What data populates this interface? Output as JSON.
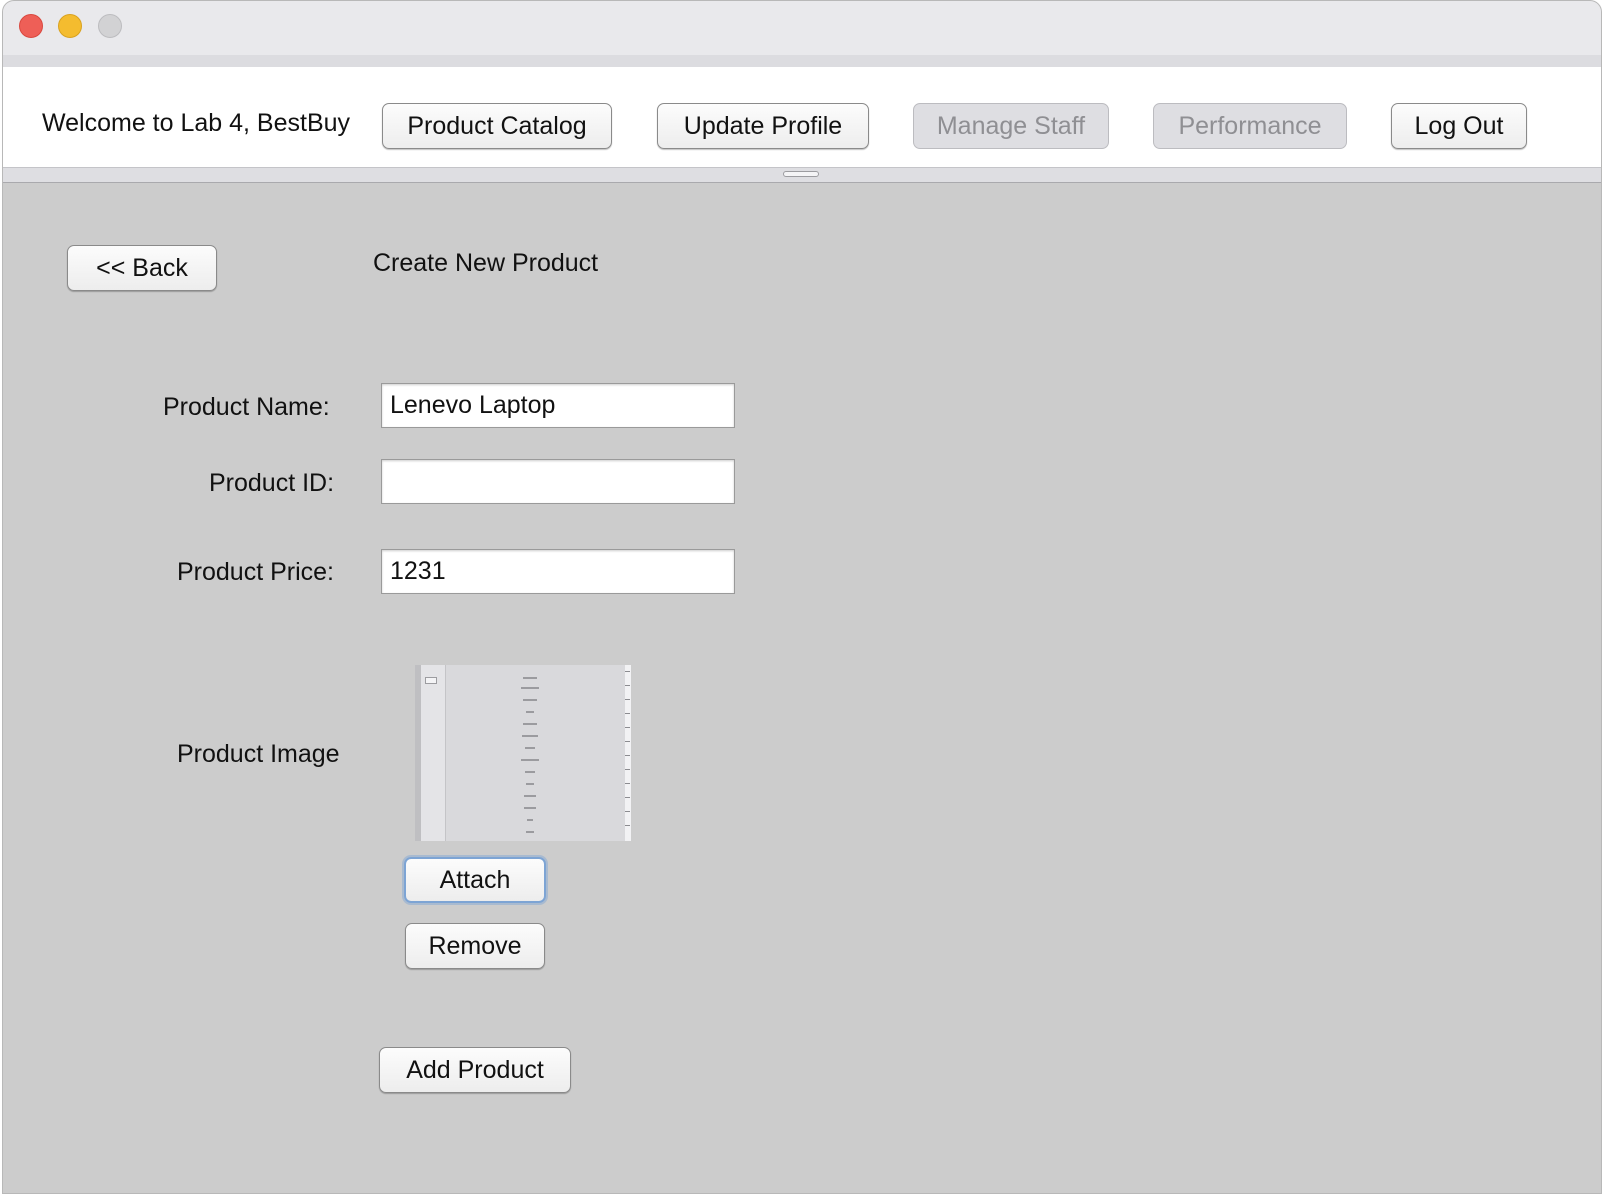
{
  "window": {
    "controls": [
      "close",
      "minimize",
      "maximize"
    ]
  },
  "header": {
    "welcome": "Welcome to Lab 4, BestBuy",
    "buttons": {
      "product_catalog": "Product Catalog",
      "update_profile": "Update Profile",
      "manage_staff": "Manage Staff",
      "performance": "Performance",
      "log_out": "Log Out"
    },
    "disabled": [
      "Manage Staff",
      "Performance"
    ]
  },
  "main": {
    "back_label": "<< Back",
    "title": "Create New Product",
    "form": {
      "name_label": "Product Name:",
      "name_value": "Lenevo Laptop",
      "id_label": "Product ID:",
      "id_value": "",
      "price_label": "Product Price:",
      "price_value": "1231",
      "image_label": "Product Image"
    },
    "attach_label": "Attach",
    "remove_label": "Remove",
    "add_label": "Add Product"
  },
  "colors": {
    "content_bg": "#cccccc",
    "focus_ring": "#7da4d4",
    "close": "#ee5f57",
    "minimize": "#f4bc2f"
  }
}
